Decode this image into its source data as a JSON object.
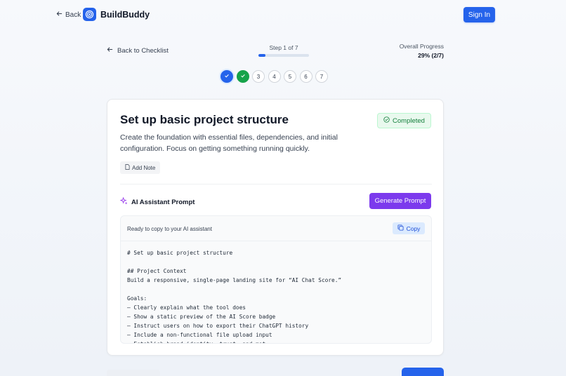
{
  "header": {
    "back_label": "Back",
    "brand_name": "BuildBuddy",
    "signin_label": "Sign In"
  },
  "progress": {
    "back_checklist_label": "Back to Checklist",
    "step_label": "Step 1 of 7",
    "step_fraction": 0.14,
    "overall_label": "Overall Progress",
    "overall_value": "29% (2/7)"
  },
  "steps": [
    {
      "label": "",
      "state": "current"
    },
    {
      "label": "",
      "state": "done"
    },
    {
      "label": "3",
      "state": "todo"
    },
    {
      "label": "4",
      "state": "todo"
    },
    {
      "label": "5",
      "state": "todo"
    },
    {
      "label": "6",
      "state": "todo"
    },
    {
      "label": "7",
      "state": "todo"
    }
  ],
  "task": {
    "title": "Set up basic project structure",
    "status": "Completed",
    "description": "Create the foundation with essential files, dependencies, and initial configuration. Focus on getting something running quickly.",
    "add_note_label": "Add Note"
  },
  "ai": {
    "title": "AI Assistant Prompt",
    "generate_label": "Generate Prompt",
    "ready_text": "Ready to copy to your AI assistant",
    "copy_label": "Copy",
    "prompt_text": "# Set up basic project structure\n\n## Project Context\nBuild a responsive, single-page landing site for “AI Chat Score.”\n\nGoals:\n– Clearly explain what the tool does\n– Show a static preview of the AI Score badge\n– Instruct users on how to export their ChatGPT history\n– Include a non-functional file upload input\n– Establish brand identity, trust, and mot"
  },
  "colors": {
    "primary": "#2563eb",
    "success": "#16a34a",
    "purple": "#7c3aed"
  }
}
